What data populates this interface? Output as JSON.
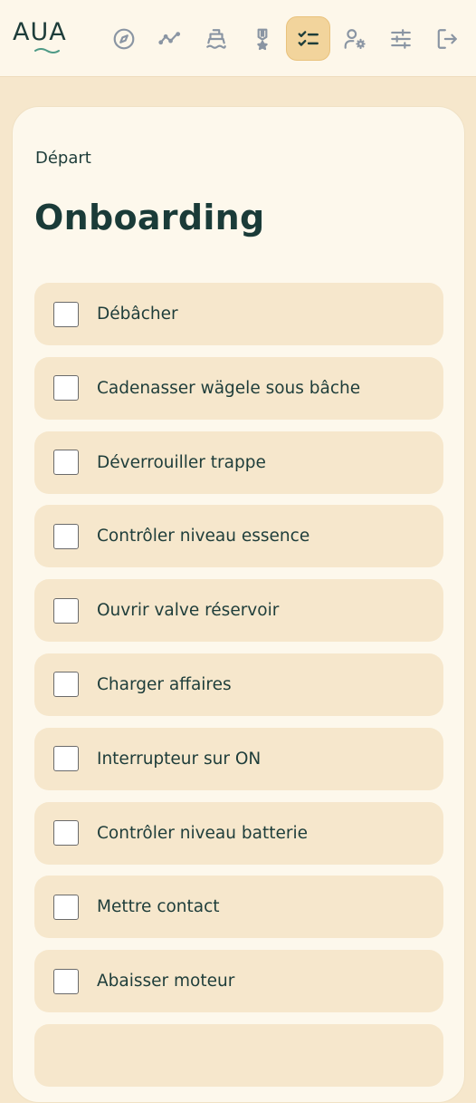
{
  "header": {
    "logo_text": "AUA",
    "nav": [
      {
        "name": "compass-icon",
        "active": false
      },
      {
        "name": "trend-line-icon",
        "active": false
      },
      {
        "name": "boat-icon",
        "active": false
      },
      {
        "name": "medal-icon",
        "active": false
      },
      {
        "name": "checklist-icon",
        "active": true
      },
      {
        "name": "user-settings-icon",
        "active": false
      },
      {
        "name": "sliders-icon",
        "active": false
      },
      {
        "name": "logout-icon",
        "active": false
      }
    ]
  },
  "main": {
    "breadcrumb": "Départ",
    "title": "Onboarding",
    "items": [
      {
        "label": "Débâcher",
        "checked": false
      },
      {
        "label": "Cadenasser wägele sous bâche",
        "checked": false
      },
      {
        "label": "Déverrouiller trappe",
        "checked": false
      },
      {
        "label": "Contrôler niveau essence",
        "checked": false
      },
      {
        "label": "Ouvrir valve réservoir",
        "checked": false
      },
      {
        "label": "Charger affaires",
        "checked": false
      },
      {
        "label": "Interrupteur sur ON",
        "checked": false
      },
      {
        "label": "Contrôler niveau batterie",
        "checked": false
      },
      {
        "label": "Mettre contact",
        "checked": false
      },
      {
        "label": "Abaisser moteur",
        "checked": false
      },
      {
        "label": "",
        "checked": false
      }
    ]
  },
  "colors": {
    "background": "#f6e7cc",
    "card": "#fdf8ec",
    "topbar": "#fdf7ea",
    "accent": "#f2d49c",
    "text": "#1e3d3a",
    "icon": "#8a95a3"
  }
}
